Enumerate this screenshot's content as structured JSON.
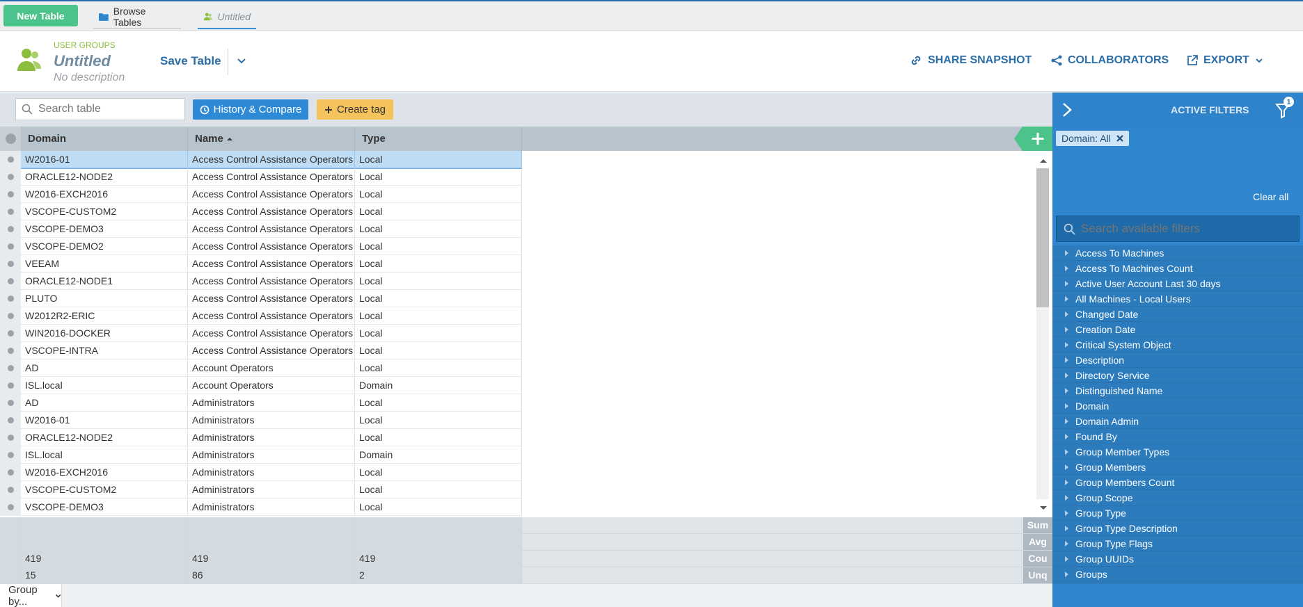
{
  "topbar": {
    "new_table": "New Table",
    "tabs": [
      {
        "label": "Browse Tables"
      },
      {
        "label": "Untitled"
      }
    ]
  },
  "header": {
    "category": "USER GROUPS",
    "title": "Untitled",
    "description": "No description",
    "save_label": "Save Table",
    "actions": {
      "share": "SHARE SNAPSHOT",
      "collaborators": "COLLABORATORS",
      "export": "EXPORT"
    }
  },
  "toolbar": {
    "search_placeholder": "Search table",
    "history_label": "History & Compare",
    "tag_label": "Create tag"
  },
  "grid": {
    "columns": [
      "Domain",
      "Name",
      "Type"
    ],
    "sorted_column": "Name",
    "rows": [
      [
        "W2016-01",
        "Access Control Assistance Operators",
        "Local"
      ],
      [
        "ORACLE12-NODE2",
        "Access Control Assistance Operators",
        "Local"
      ],
      [
        "W2016-EXCH2016",
        "Access Control Assistance Operators",
        "Local"
      ],
      [
        "VSCOPE-CUSTOM2",
        "Access Control Assistance Operators",
        "Local"
      ],
      [
        "VSCOPE-DEMO3",
        "Access Control Assistance Operators",
        "Local"
      ],
      [
        "VSCOPE-DEMO2",
        "Access Control Assistance Operators",
        "Local"
      ],
      [
        "VEEAM",
        "Access Control Assistance Operators",
        "Local"
      ],
      [
        "ORACLE12-NODE1",
        "Access Control Assistance Operators",
        "Local"
      ],
      [
        "PLUTO",
        "Access Control Assistance Operators",
        "Local"
      ],
      [
        "W2012R2-ERIC",
        "Access Control Assistance Operators",
        "Local"
      ],
      [
        "WIN2016-DOCKER",
        "Access Control Assistance Operators",
        "Local"
      ],
      [
        "VSCOPE-INTRA",
        "Access Control Assistance Operators",
        "Local"
      ],
      [
        "AD",
        "Account Operators",
        "Local"
      ],
      [
        "ISL.local",
        "Account Operators",
        "Domain"
      ],
      [
        "AD",
        "Administrators",
        "Local"
      ],
      [
        "W2016-01",
        "Administrators",
        "Local"
      ],
      [
        "ORACLE12-NODE2",
        "Administrators",
        "Local"
      ],
      [
        "ISL.local",
        "Administrators",
        "Domain"
      ],
      [
        "W2016-EXCH2016",
        "Administrators",
        "Local"
      ],
      [
        "VSCOPE-CUSTOM2",
        "Administrators",
        "Local"
      ],
      [
        "VSCOPE-DEMO3",
        "Administrators",
        "Local"
      ]
    ],
    "aggregates": [
      {
        "label": "Sum",
        "values": [
          "",
          "",
          ""
        ]
      },
      {
        "label": "Avg",
        "values": [
          "",
          "",
          ""
        ]
      },
      {
        "label": "Cou",
        "values": [
          "419",
          "419",
          "419"
        ]
      },
      {
        "label": "Unq",
        "values": [
          "15",
          "86",
          "2"
        ]
      }
    ]
  },
  "bottom": {
    "group_by": "Group by..."
  },
  "filters": {
    "title": "ACTIVE FILTERS",
    "badge": "1",
    "active_chip": "Domain: All",
    "clear_all": "Clear all",
    "search_placeholder": "Search available filters",
    "items": [
      "Access To Machines",
      "Access To Machines Count",
      "Active User Account Last 30 days",
      "All Machines - Local Users",
      "Changed Date",
      "Creation Date",
      "Critical System Object",
      "Description",
      "Directory Service",
      "Distinguished Name",
      "Domain",
      "Domain Admin",
      "Found By",
      "Group Member Types",
      "Group Members",
      "Group Members Count",
      "Group Scope",
      "Group Type",
      "Group Type Description",
      "Group Type Flags",
      "Group UUIDs",
      "Groups"
    ]
  },
  "colors": {
    "accent": "#2f86cf",
    "new_button": "#4cc38a",
    "tag_button": "#f5c35b",
    "category": "#8cbd3c"
  }
}
